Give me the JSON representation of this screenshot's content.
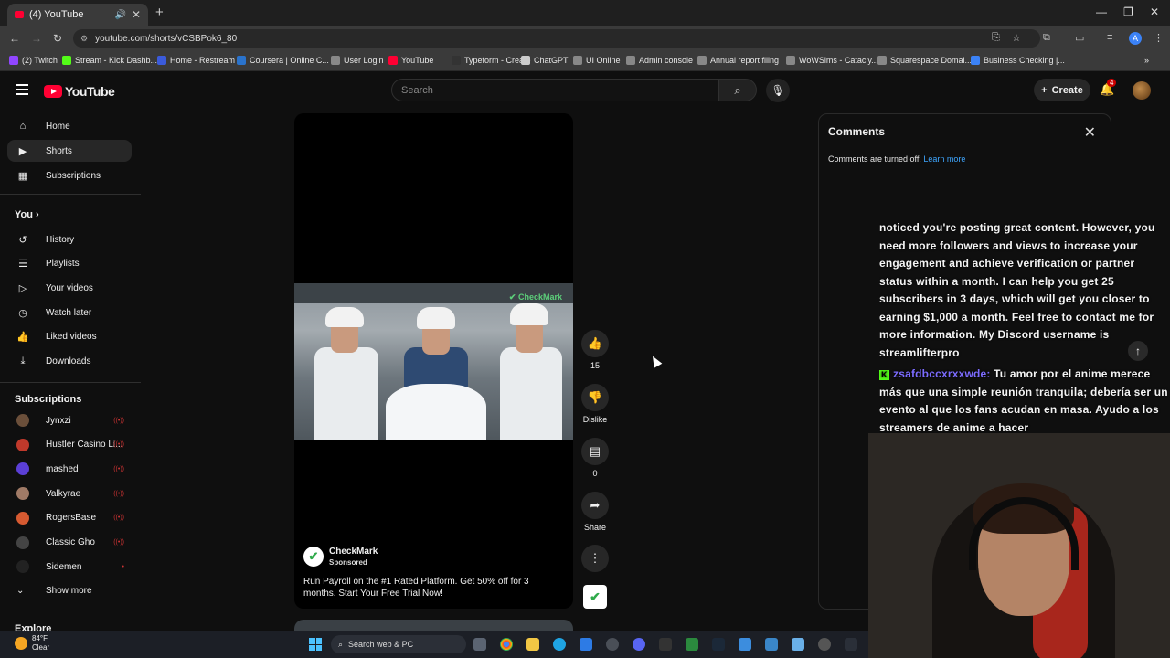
{
  "browser": {
    "tab_title": "(4) YouTube",
    "url": "youtube.com/shorts/vCSBPok6_80",
    "bookmarks": [
      {
        "label": "(2) Twitch",
        "color": "#9146ff"
      },
      {
        "label": "Stream - Kick Dashb...",
        "color": "#53fc18"
      },
      {
        "label": "Home - Restream",
        "color": "#3b5bdb"
      },
      {
        "label": "Coursera | Online C...",
        "color": "#2a73cc"
      },
      {
        "label": "User Login",
        "color": "#888888"
      },
      {
        "label": "YouTube",
        "color": "#ff0033"
      },
      {
        "label": "Typeform - Create",
        "color": "#333333"
      },
      {
        "label": "ChatGPT",
        "color": "#cccccc"
      },
      {
        "label": "UI Online",
        "color": "#888888"
      },
      {
        "label": "Admin console",
        "color": "#888888"
      },
      {
        "label": "Annual report filing",
        "color": "#888888"
      },
      {
        "label": "WoWSims - Catacly...",
        "color": "#888888"
      },
      {
        "label": "Squarespace Domai...",
        "color": "#888888"
      },
      {
        "label": "Business Checking |...",
        "color": "#3b82f6"
      }
    ],
    "profile_initial": "A"
  },
  "youtube": {
    "logo_text": "YouTube",
    "search_placeholder": "Search",
    "create_label": "Create",
    "notification_count": "4",
    "sidebar": {
      "main": [
        {
          "label": "Home",
          "icon": "home-icon"
        },
        {
          "label": "Shorts",
          "icon": "shorts-icon"
        },
        {
          "label": "Subscriptions",
          "icon": "subscriptions-icon"
        }
      ],
      "you_label": "You",
      "you_items": [
        {
          "label": "History",
          "icon": "history-icon"
        },
        {
          "label": "Playlists",
          "icon": "playlists-icon"
        },
        {
          "label": "Your videos",
          "icon": "your-videos-icon"
        },
        {
          "label": "Watch later",
          "icon": "watch-later-icon"
        },
        {
          "label": "Liked videos",
          "icon": "liked-videos-icon"
        },
        {
          "label": "Downloads",
          "icon": "downloads-icon"
        }
      ],
      "subscriptions_label": "Subscriptions",
      "subscriptions": [
        {
          "label": "Jynxzi",
          "color": "#6b4f3a"
        },
        {
          "label": "Hustler Casino Li...",
          "color": "#c0392b"
        },
        {
          "label": "mashed",
          "color": "#5b3fd6"
        },
        {
          "label": "Valkyrae",
          "color": "#a07a66"
        },
        {
          "label": "RogersBase",
          "color": "#d65a31"
        },
        {
          "label": "Classic Gho",
          "color": "#444444"
        },
        {
          "label": "Sidemen",
          "color": "#222222"
        }
      ],
      "show_more_label": "Show more",
      "explore_label": "Explore"
    },
    "short": {
      "channel": "CheckMark",
      "sponsored": "Sponsored",
      "description": "Run Payroll on the #1 Rated Platform. Get 50% off for 3 months. Start Your Free Trial Now!",
      "watermark": "CheckMark",
      "likes": "15",
      "dislike_label": "Dislike",
      "comments_count": "0",
      "share_label": "Share"
    },
    "comments_panel": {
      "title": "Comments",
      "status": "Comments are turned off.",
      "learn_more": "Learn more"
    }
  },
  "overlay": {
    "chat_text_1": "noticed you're posting great content. However, you need more followers and views to increase your engagement and achieve verification or partner status within a month. I can help you get 25 subscribers in 3 days, which will get you closer to earning $1,000 a month. Feel free to contact me for more information. My Discord username is streamlifterpro",
    "chat_user": "zsafdbccxrxxwde:",
    "chat_text_2": "Tu amor por el anime merece más que una simple reunión tranquila; debería ser un evento al que los fans acudan en masa. Ayudo a los streamers de anime a hacer"
  },
  "taskbar": {
    "temperature": "84°F",
    "condition": "Clear",
    "search_label": "Search web & PC"
  }
}
